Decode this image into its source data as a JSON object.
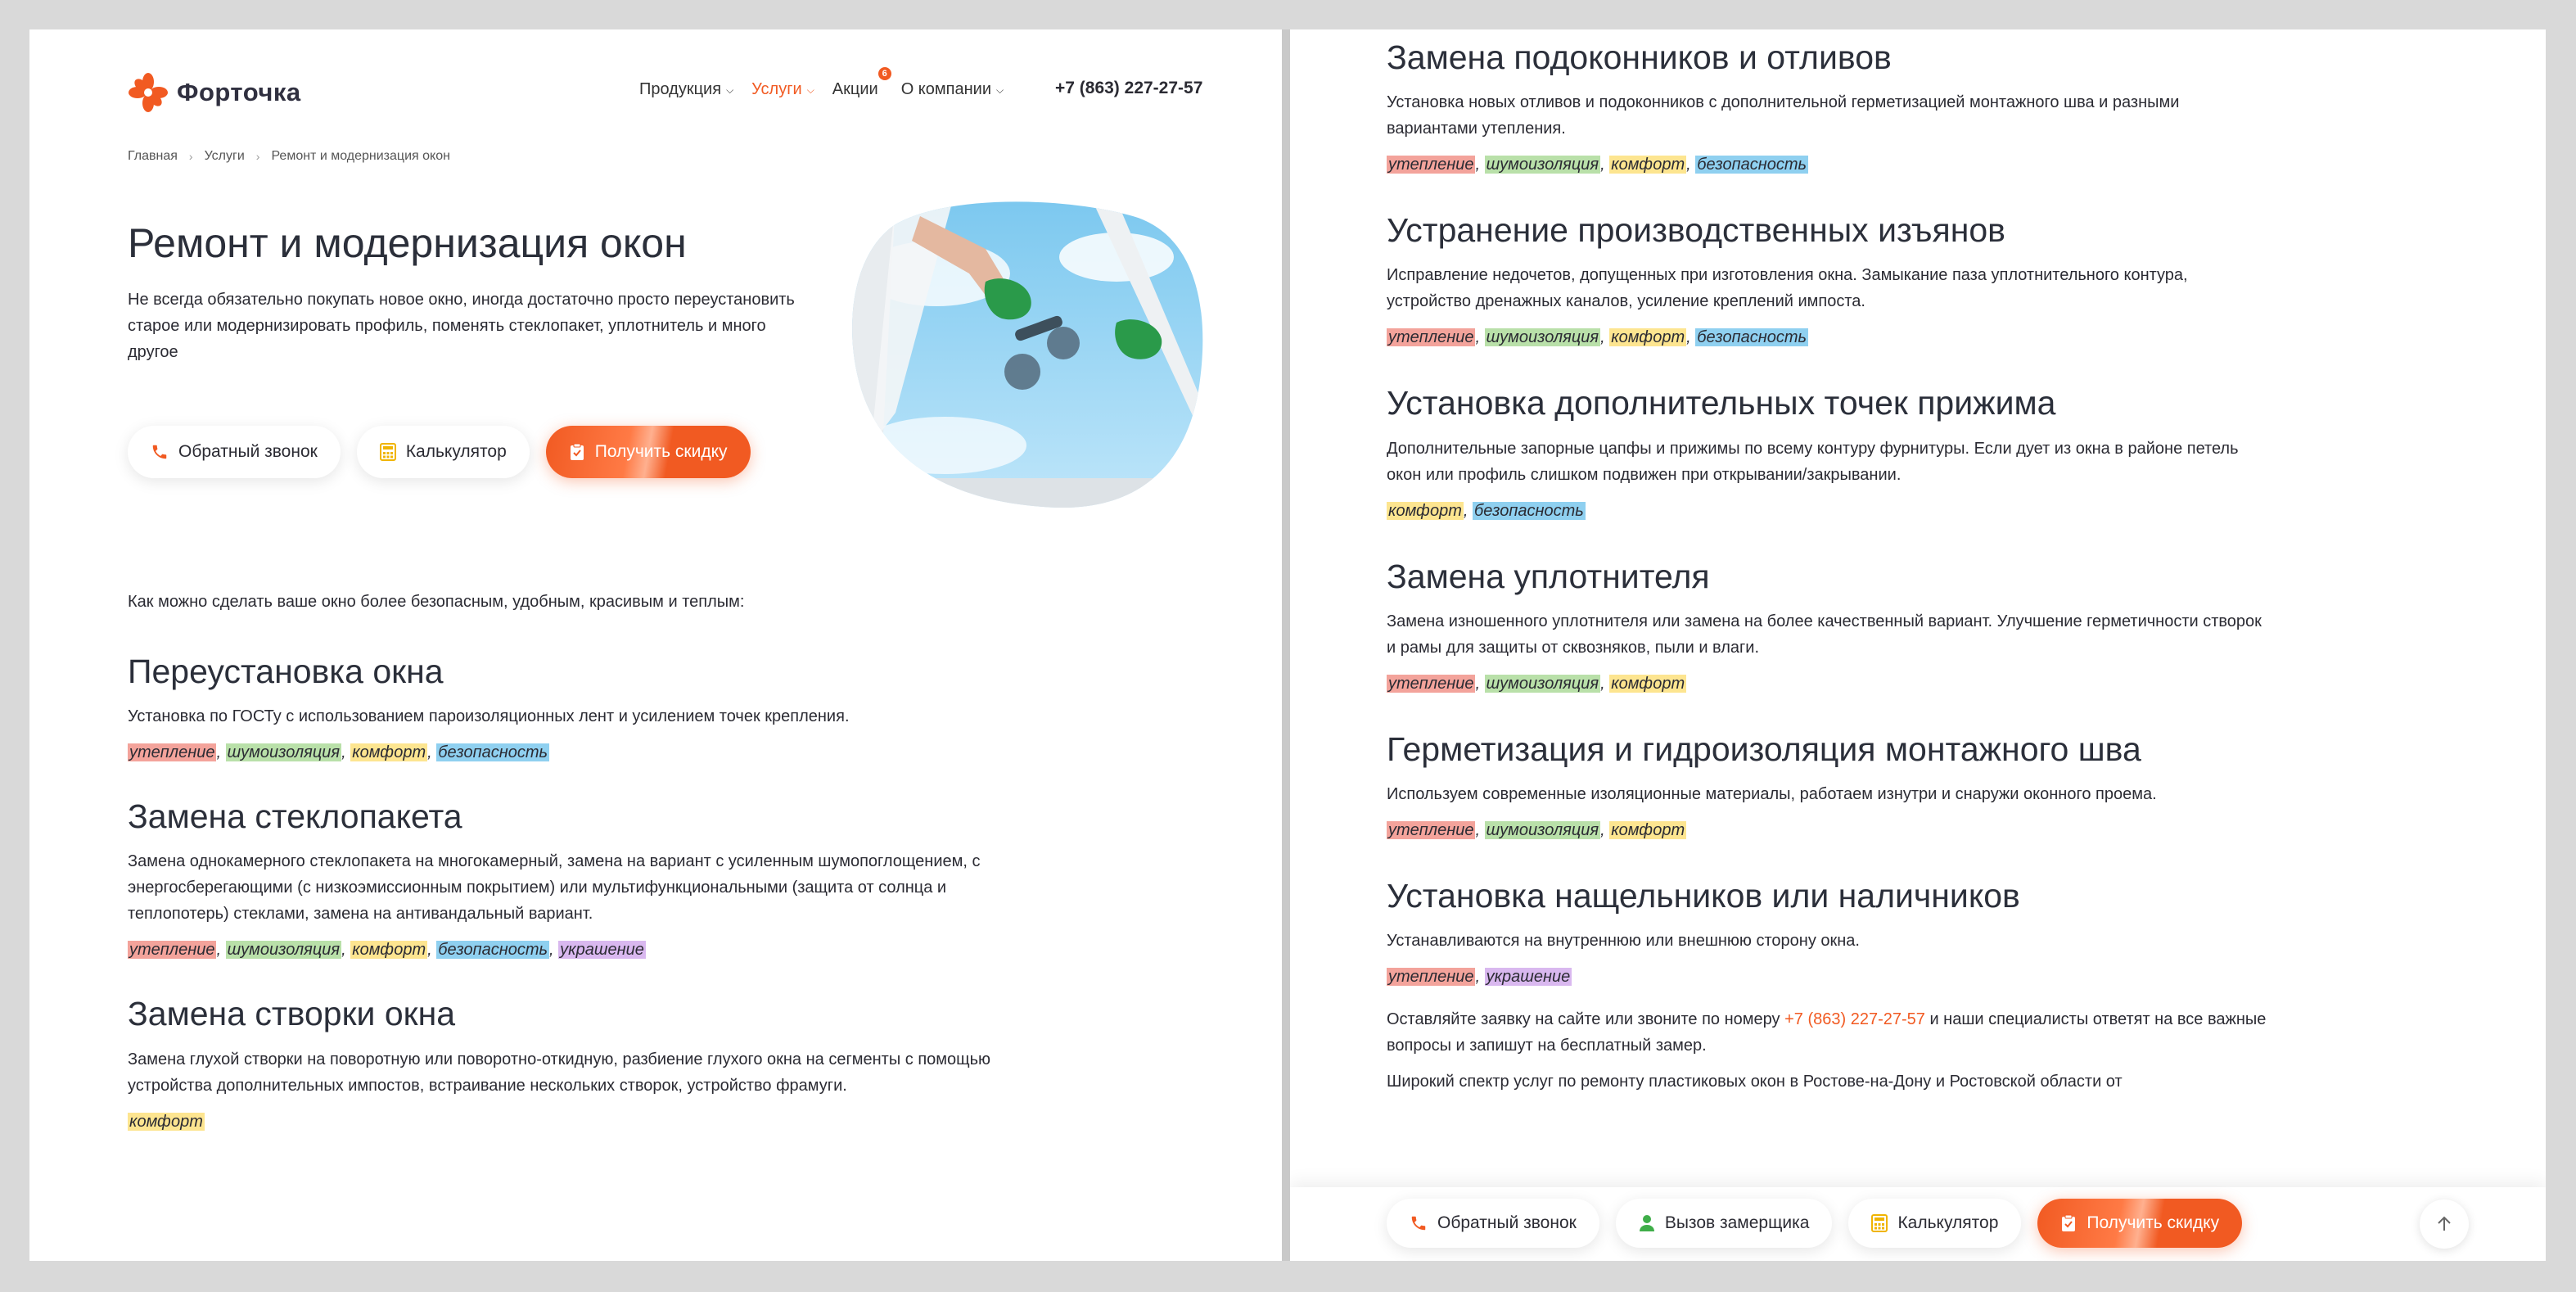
{
  "header": {
    "logo_text": "Форточка",
    "nav": [
      {
        "label": "Продукция",
        "active": false
      },
      {
        "label": "Услуги",
        "active": true
      },
      {
        "label": "Акции",
        "active": false,
        "badge": "6"
      },
      {
        "label": "О компании",
        "active": false
      }
    ],
    "phone": "+7 (863) 227-27-57"
  },
  "breadcrumb": [
    "Главная",
    "Услуги",
    "Ремонт и модернизация окон"
  ],
  "hero": {
    "title": "Ремонт и модернизация окон",
    "description": "Не всегда обязательно покупать новое окно, иногда достаточно просто переустановить старое или модернизировать профиль, поменять стеклопакет, уплотнитель и много другое"
  },
  "buttons": {
    "callback": "Обратный звонок",
    "calculator": "Калькулятор",
    "discount": "Получить скидку",
    "measurer": "Вызов замерщика"
  },
  "intro": "Как можно сделать ваше окно более безопасным, удобным, красивым и теплым:",
  "services_left": [
    {
      "title": "Переустановка окна",
      "text": "Установка по ГОСТу с использованием пароизоляционных лент и усилением точек крепления.",
      "tags": [
        "утепление",
        "шумоизоляция",
        "комфорт",
        "безопасность"
      ]
    },
    {
      "title": "Замена стеклопакета",
      "text": "Замена однокамерного стеклопакета на многокамерный, замена на вариант с усиленным шумопоглощением, с энергосберегающими (с низкоэмиссионным покрытием) или мультифункциональными (защита от солнца и теплопотерь) стеклами, замена на антивандальный вариант.",
      "tags": [
        "утепление",
        "шумоизоляция",
        "комфорт",
        "безопасность",
        "украшение"
      ]
    },
    {
      "title": "Замена створки окна",
      "text": "Замена глухой створки на поворотную или поворотно-откидную, разбиение глухого окна на сегменты с помощью устройства дополнительных импостов, встраивание нескольких створок, устройство фрамуги.",
      "tags": [
        "комфорт"
      ]
    }
  ],
  "services_right": [
    {
      "title": "Замена подоконников и отливов",
      "text": "Установка новых отливов и подоконников с дополнительной герметизацией монтажного шва и разными вариантами утепления.",
      "tags": [
        "утепление",
        "шумоизоляция",
        "комфорт",
        "безопасность"
      ]
    },
    {
      "title": "Устранение производственных изъянов",
      "text": "Исправление недочетов, допущенных при изготовления окна. Замыкание паза уплотнительного контура, устройство дренажных каналов, усиление креплений импоста.",
      "tags": [
        "утепление",
        "шумоизоляция",
        "комфорт",
        "безопасность"
      ]
    },
    {
      "title": "Установка дополнительных точек прижима",
      "text": "Дополнительные запорные цапфы и прижимы по всему контуру фурнитуры. Если дует из окна в районе петель окон или профиль слишком подвижен при открывании/закрывании.",
      "tags": [
        "комфорт",
        "безопасность"
      ]
    },
    {
      "title": "Замена уплотнителя",
      "text": "Замена изношенного уплотнителя или замена на более качественный вариант. Улучшение герметичности створок и рамы для защиты от сквозняков, пыли и влаги.",
      "tags": [
        "утепление",
        "шумоизоляция",
        "комфорт"
      ]
    },
    {
      "title": "Герметизация и гидроизоляция монтажного шва",
      "text": "Используем современные изоляционные материалы, работаем изнутри и снаружи оконного проема.",
      "tags": [
        "утепление",
        "шумоизоляция",
        "комфорт"
      ]
    },
    {
      "title": "Установка нащельников или наличников",
      "text": "Устанавливаются на внутреннюю или внешнюю сторону окна.",
      "tags": [
        "утепление",
        "украшение"
      ]
    }
  ],
  "contact": {
    "before": "Оставляйте заявку на сайте или звоните по номеру ",
    "phone": "+7 (863) 227-27-57",
    "after": " и наши специалисты ответят на все важные вопросы и запишут на бесплатный замер.",
    "more": "Широкий спектр услуг по ремонту пластиковых окон в Ростове-на-Дону и Ростовской области от"
  },
  "tag_colors": {
    "утепление": "#f3a39b",
    "шумоизоляция": "#b9e0a9",
    "комфорт": "#fde590",
    "безопасность": "#8fd0f0",
    "украшение": "#d9b8ef"
  },
  "accent_color": "#f15a22"
}
